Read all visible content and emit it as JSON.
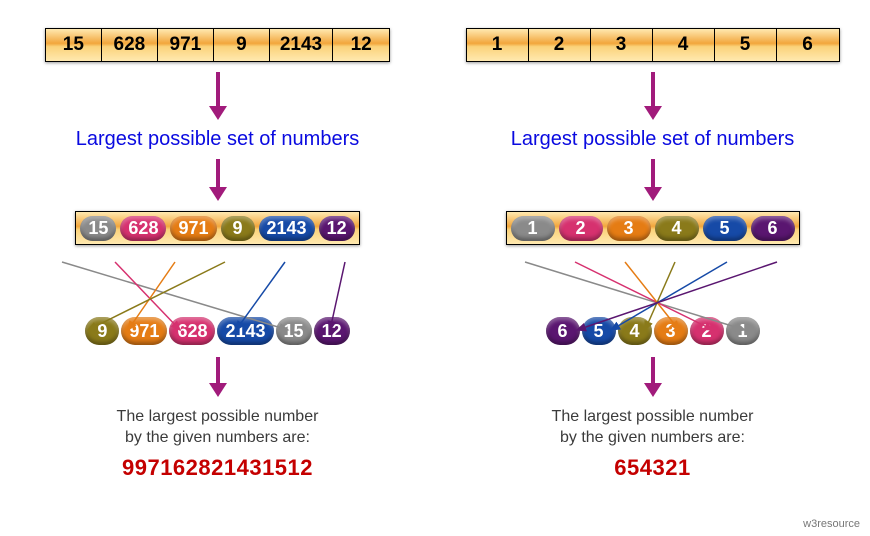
{
  "left": {
    "input": [
      "15",
      "628",
      "971",
      "9",
      "2143",
      "12"
    ],
    "caption": "Largest possible set of numbers",
    "pills": [
      {
        "v": "15",
        "c": "gray"
      },
      {
        "v": "628",
        "c": "pink"
      },
      {
        "v": "971",
        "c": "orange"
      },
      {
        "v": "9",
        "c": "olive"
      },
      {
        "v": "2143",
        "c": "blue"
      },
      {
        "v": "12",
        "c": "purple"
      }
    ],
    "sorted": [
      {
        "v": "9",
        "c": "olive"
      },
      {
        "v": "971",
        "c": "orange"
      },
      {
        "v": "628",
        "c": "pink"
      },
      {
        "v": "2143",
        "c": "blue"
      },
      {
        "v": "15",
        "c": "gray"
      },
      {
        "v": "12",
        "c": "purple"
      }
    ],
    "result_text_l1": "The largest possible number",
    "result_text_l2": "by the given numbers are:",
    "result": "997162821431512"
  },
  "right": {
    "input": [
      "1",
      "2",
      "3",
      "4",
      "5",
      "6"
    ],
    "caption": "Largest possible set of numbers",
    "pills": [
      {
        "v": "1",
        "c": "gray"
      },
      {
        "v": "2",
        "c": "pink"
      },
      {
        "v": "3",
        "c": "orange"
      },
      {
        "v": "4",
        "c": "olive"
      },
      {
        "v": "5",
        "c": "blue"
      },
      {
        "v": "6",
        "c": "purple"
      }
    ],
    "sorted": [
      {
        "v": "6",
        "c": "purple"
      },
      {
        "v": "5",
        "c": "blue"
      },
      {
        "v": "4",
        "c": "olive"
      },
      {
        "v": "3",
        "c": "orange"
      },
      {
        "v": "2",
        "c": "pink"
      },
      {
        "v": "1",
        "c": "gray"
      }
    ],
    "result_text_l1": "The largest possible number",
    "result_text_l2": "by the given numbers are:",
    "result": "654321"
  },
  "footer": "w3resource"
}
